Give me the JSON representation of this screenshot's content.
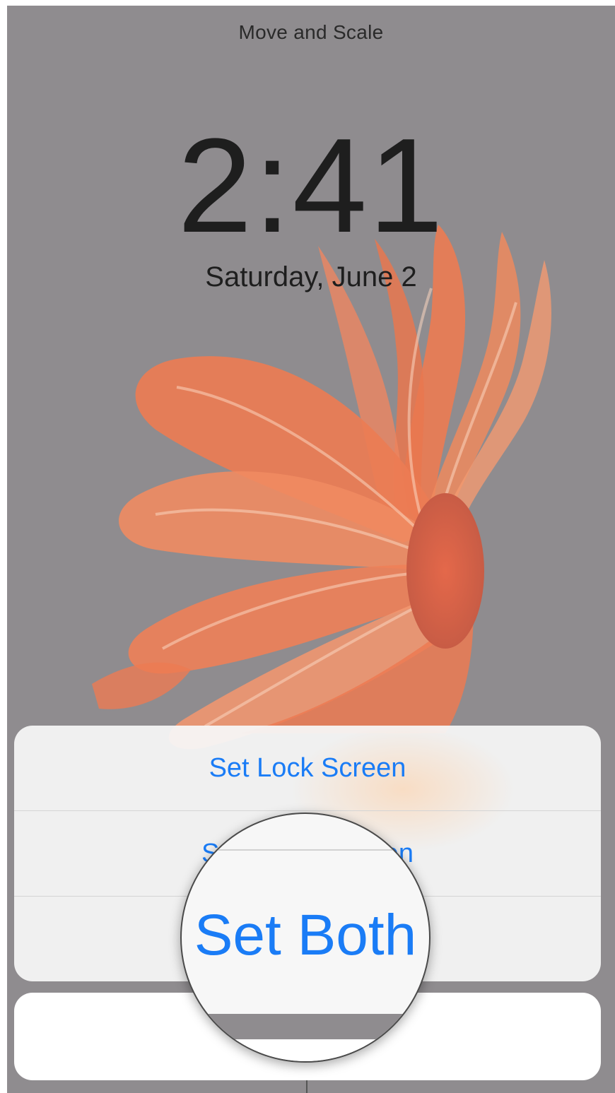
{
  "header": {
    "title": "Move and Scale"
  },
  "lock_screen": {
    "time": "2:41",
    "date": "Saturday, June 2"
  },
  "action_sheet": {
    "items": [
      {
        "label": "Set Lock Screen"
      },
      {
        "label": "Set Home Screen"
      },
      {
        "label": "Set Both"
      }
    ],
    "cancel_label": ""
  },
  "magnifier": {
    "label": "Set Both"
  },
  "colors": {
    "accent": "#1a7cf6",
    "background_gray": "#8f8c8f",
    "fish_orange": "#ec7448"
  },
  "icons": {
    "wallpaper": "betta-fish-wallpaper"
  }
}
